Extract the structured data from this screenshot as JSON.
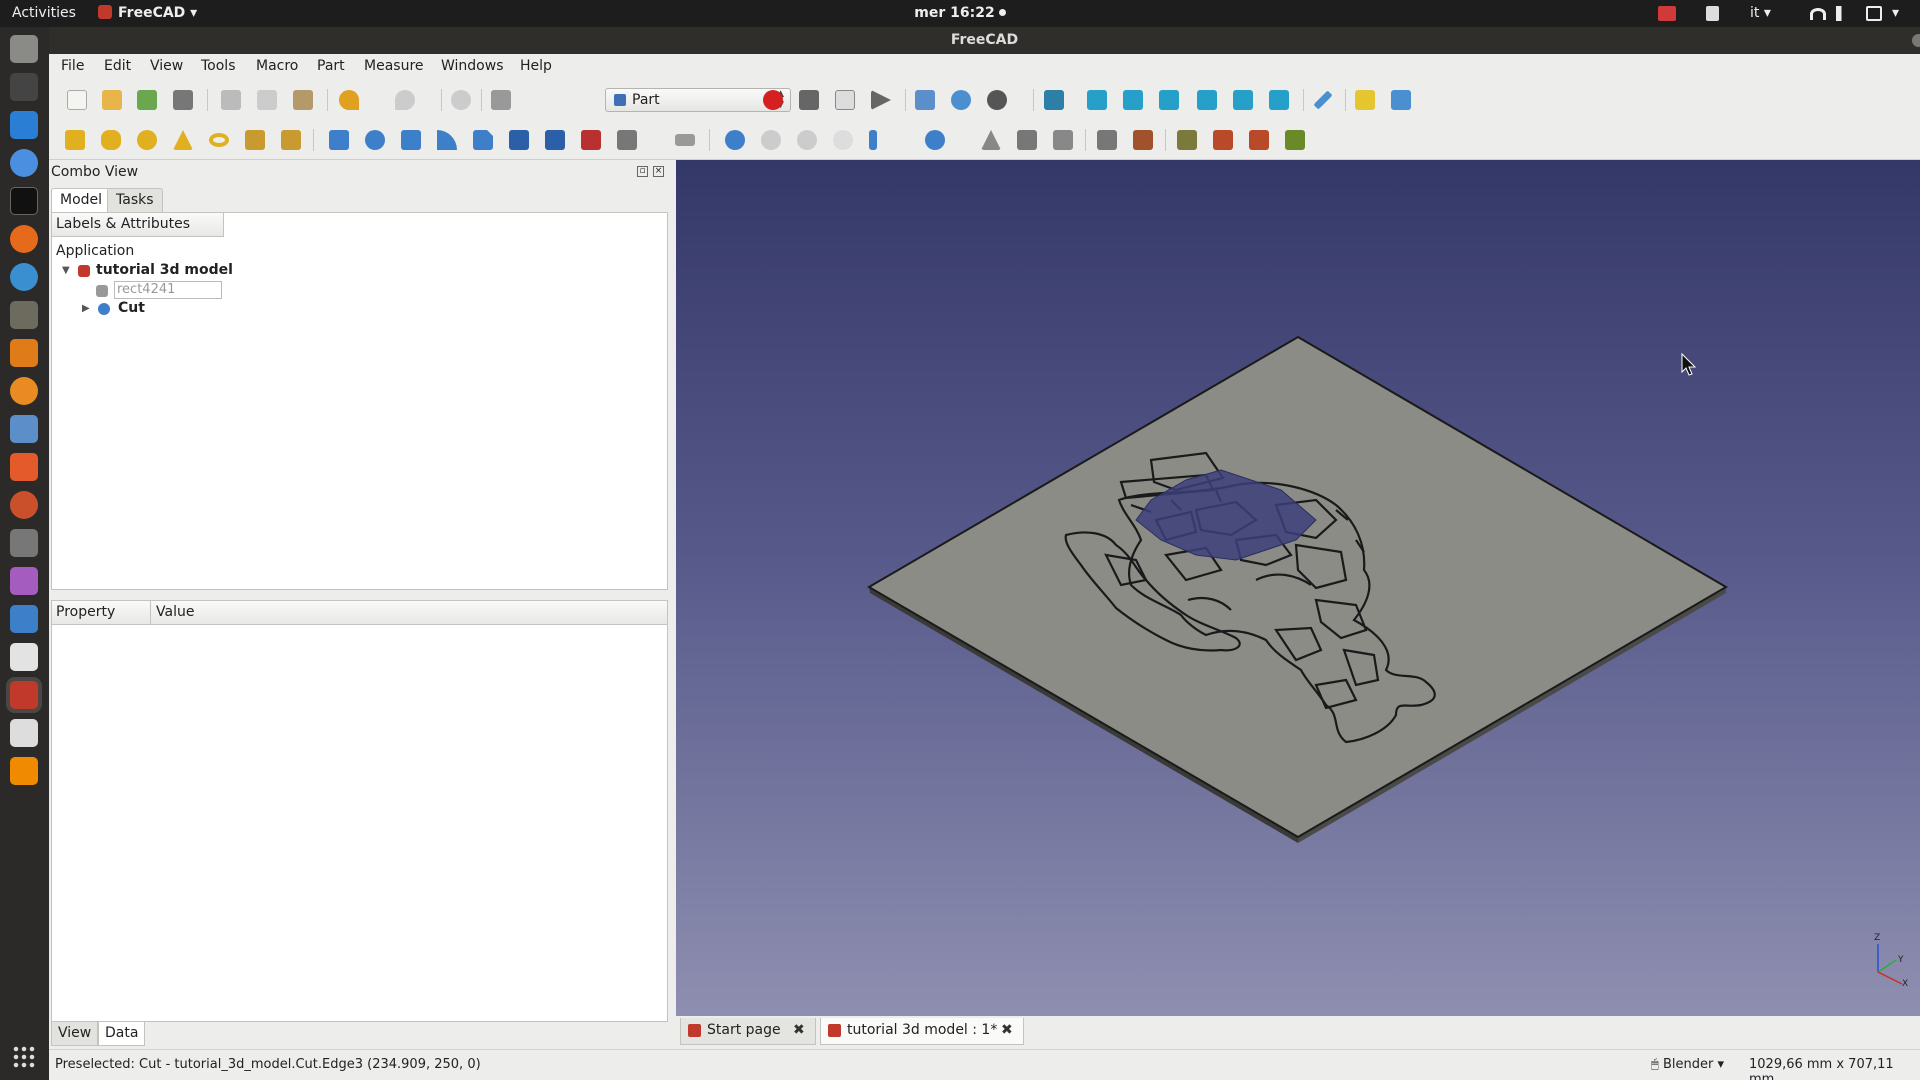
{
  "topbar": {
    "activities": "Activities",
    "app_name": "FreeCAD",
    "clock": "mer 16:22",
    "language": "it"
  },
  "window": {
    "title": "FreeCAD"
  },
  "menu": [
    "File",
    "Edit",
    "View",
    "Tools",
    "Macro",
    "Part",
    "Measure",
    "Windows",
    "Help"
  ],
  "workbench": {
    "selected": "Part"
  },
  "combo_view": {
    "title": "Combo View",
    "tabs": [
      "Model",
      "Tasks"
    ],
    "tree_header": "Labels & Attributes",
    "tree": {
      "root": "Application",
      "document": "tutorial 3d model",
      "children": [
        "rect4241",
        "Cut"
      ]
    },
    "property_columns": [
      "Property",
      "Value"
    ],
    "bottom_tabs": [
      "View",
      "Data"
    ]
  },
  "doc_tabs": [
    "Start page",
    "tutorial 3d model : 1*"
  ],
  "axis_labels": {
    "z": "Z",
    "y": "Y",
    "x": "X"
  },
  "status": {
    "message": "Preselected: Cut - tutorial_3d_model.Cut.Edge3 (234.909, 250, 0)",
    "navigation": "Blender",
    "dimensions": "1029,66 mm x 707,11 mm"
  },
  "colors": {
    "accent_close": "#e95420",
    "plate": "#8c8c87",
    "background_top": "#343868",
    "background_bottom": "#8e8fb0"
  }
}
